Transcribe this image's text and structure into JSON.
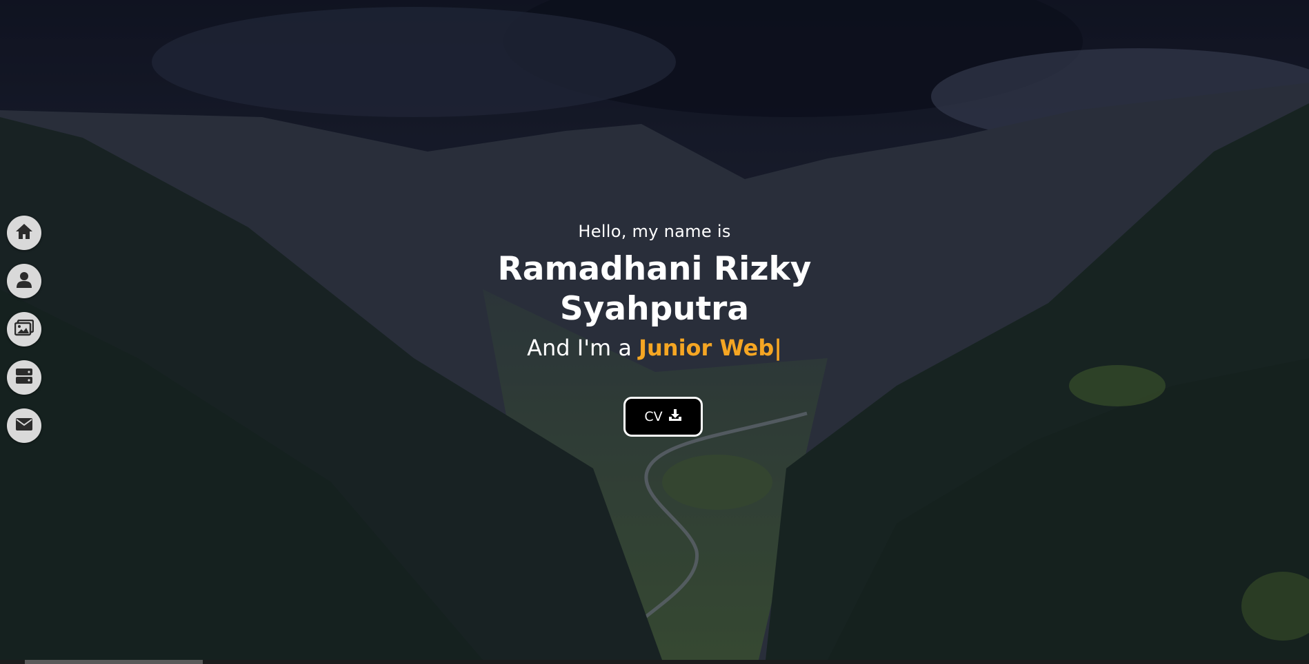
{
  "hero": {
    "greeting": "Hello, my name is",
    "name_line1": "Ramadhani Rizky",
    "name_line2": "Syahputra",
    "role_prefix": "And I'm a",
    "role_typed": "Junior Web|",
    "cv_label": "CV"
  },
  "sidebar": {
    "items": [
      {
        "icon": "home-icon"
      },
      {
        "icon": "user-icon"
      },
      {
        "icon": "images-icon"
      },
      {
        "icon": "server-icon"
      },
      {
        "icon": "envelope-icon"
      }
    ]
  },
  "colors": {
    "accent": "#f5a623",
    "button_bg": "#000000",
    "sidebar_button_bg": "#d9d9d9",
    "text": "#ffffff"
  }
}
